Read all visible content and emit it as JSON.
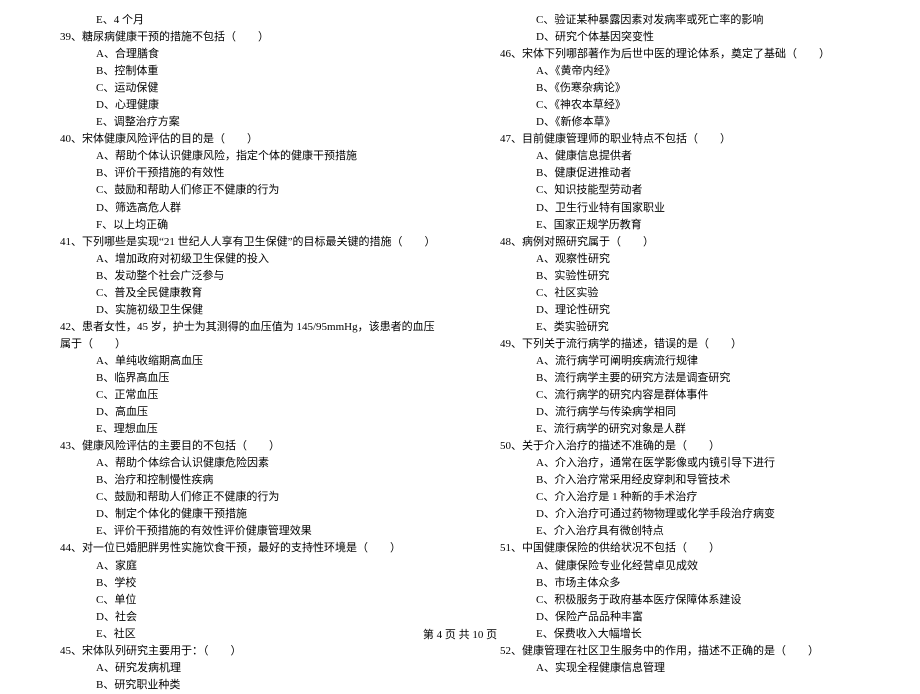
{
  "left_column": {
    "lines": [
      {
        "cls": "option-line",
        "text": "E、4 个月"
      },
      {
        "cls": "question-line",
        "text": "39、糖尿病健康干预的措施不包括（　　）"
      },
      {
        "cls": "option-line",
        "text": "A、合理膳食"
      },
      {
        "cls": "option-line",
        "text": "B、控制体重"
      },
      {
        "cls": "option-line",
        "text": "C、运动保健"
      },
      {
        "cls": "option-line",
        "text": "D、心理健康"
      },
      {
        "cls": "option-line",
        "text": "E、调整治疗方案"
      },
      {
        "cls": "question-line",
        "text": "40、宋体健康风险评估的目的是（　　）"
      },
      {
        "cls": "option-line",
        "text": "A、帮助个体认识健康风险，指定个体的健康干预措施"
      },
      {
        "cls": "option-line",
        "text": "B、评价干预措施的有效性"
      },
      {
        "cls": "option-line",
        "text": "C、鼓励和帮助人们修正不健康的行为"
      },
      {
        "cls": "option-line",
        "text": "D、筛选高危人群"
      },
      {
        "cls": "option-line",
        "text": "F、以上均正确"
      },
      {
        "cls": "question-line",
        "text": "41、下列哪些是实现“21 世纪人人享有卫生保健”的目标最关键的措施（　　）"
      },
      {
        "cls": "option-line",
        "text": "A、增加政府对初级卫生保健的投入"
      },
      {
        "cls": "option-line",
        "text": "B、发动整个社会广泛参与"
      },
      {
        "cls": "option-line",
        "text": "C、普及全民健康教育"
      },
      {
        "cls": "option-line",
        "text": "D、实施初级卫生保健"
      },
      {
        "cls": "question-line",
        "text": "42、患者女性，45 岁，护士为其测得的血压值为 145/95mmHg，该患者的血压属于（　　）"
      },
      {
        "cls": "option-line",
        "text": "A、单纯收缩期高血压"
      },
      {
        "cls": "option-line",
        "text": "B、临界高血压"
      },
      {
        "cls": "option-line",
        "text": "C、正常血压"
      },
      {
        "cls": "option-line",
        "text": "D、高血压"
      },
      {
        "cls": "option-line",
        "text": "E、理想血压"
      },
      {
        "cls": "question-line",
        "text": "43、健康风险评估的主要目的不包括（　　）"
      },
      {
        "cls": "option-line",
        "text": "A、帮助个体综合认识健康危险因素"
      },
      {
        "cls": "option-line",
        "text": "B、治疗和控制慢性疾病"
      },
      {
        "cls": "option-line",
        "text": "C、鼓励和帮助人们修正不健康的行为"
      },
      {
        "cls": "option-line",
        "text": "D、制定个体化的健康干预措施"
      },
      {
        "cls": "option-line",
        "text": "E、评价干预措施的有效性评价健康管理效果"
      },
      {
        "cls": "question-line",
        "text": "44、对一位已婚肥胖男性实施饮食干预，最好的支持性环境是（　　）"
      },
      {
        "cls": "option-line",
        "text": "A、家庭"
      },
      {
        "cls": "option-line",
        "text": "B、学校"
      },
      {
        "cls": "option-line",
        "text": "C、单位"
      },
      {
        "cls": "option-line",
        "text": "D、社会"
      },
      {
        "cls": "option-line",
        "text": "E、社区"
      },
      {
        "cls": "question-line",
        "text": "45、宋体队列研究主要用于：（　　）"
      },
      {
        "cls": "option-line",
        "text": "A、研究发病机理"
      },
      {
        "cls": "option-line",
        "text": "B、研究职业种类"
      }
    ]
  },
  "right_column": {
    "lines": [
      {
        "cls": "option-line",
        "text": "C、验证某种暴露因素对发病率或死亡率的影响"
      },
      {
        "cls": "option-line",
        "text": "D、研究个体基因突变性"
      },
      {
        "cls": "question-line",
        "text": "46、宋体下列哪部著作为后世中医的理论体系，奠定了基础（　　）"
      },
      {
        "cls": "option-line",
        "text": "A、《黄帝内经》"
      },
      {
        "cls": "option-line",
        "text": "B、《伤寒杂病论》"
      },
      {
        "cls": "option-line",
        "text": "C、《神农本草经》"
      },
      {
        "cls": "option-line",
        "text": "D、《新修本草》"
      },
      {
        "cls": "question-line",
        "text": "47、目前健康管理师的职业特点不包括（　　）"
      },
      {
        "cls": "option-line",
        "text": "A、健康信息提供者"
      },
      {
        "cls": "option-line",
        "text": "B、健康促进推动者"
      },
      {
        "cls": "option-line",
        "text": "C、知识技能型劳动者"
      },
      {
        "cls": "option-line",
        "text": "D、卫生行业特有国家职业"
      },
      {
        "cls": "option-line",
        "text": "E、国家正规学历教育"
      },
      {
        "cls": "question-line",
        "text": "48、病例对照研究属于（　　）"
      },
      {
        "cls": "option-line",
        "text": "A、观察性研究"
      },
      {
        "cls": "option-line",
        "text": "B、实验性研究"
      },
      {
        "cls": "option-line",
        "text": "C、社区实验"
      },
      {
        "cls": "option-line",
        "text": "D、理论性研究"
      },
      {
        "cls": "option-line",
        "text": "E、类实验研究"
      },
      {
        "cls": "question-line",
        "text": "49、下列关于流行病学的描述，错误的是（　　）"
      },
      {
        "cls": "option-line",
        "text": "A、流行病学可阐明疾病流行规律"
      },
      {
        "cls": "option-line",
        "text": "B、流行病学主要的研究方法是调查研究"
      },
      {
        "cls": "option-line",
        "text": "C、流行病学的研究内容是群体事件"
      },
      {
        "cls": "option-line",
        "text": "D、流行病学与传染病学相同"
      },
      {
        "cls": "option-line",
        "text": "E、流行病学的研究对象是人群"
      },
      {
        "cls": "question-line",
        "text": "50、关于介入治疗的描述不准确的是（　　）"
      },
      {
        "cls": "option-line",
        "text": "A、介入治疗，通常在医学影像或内镜引导下进行"
      },
      {
        "cls": "option-line",
        "text": "B、介入治疗常采用经皮穿刺和导管技术"
      },
      {
        "cls": "option-line",
        "text": "C、介入治疗是 1 种新的手术治疗"
      },
      {
        "cls": "option-line",
        "text": "D、介入治疗可通过药物物理或化学手段治疗病变"
      },
      {
        "cls": "option-line",
        "text": "E、介入治疗具有微创特点"
      },
      {
        "cls": "question-line",
        "text": "51、中国健康保险的供给状况不包括（　　）"
      },
      {
        "cls": "option-line",
        "text": "A、健康保险专业化经营卓见成效"
      },
      {
        "cls": "option-line",
        "text": "B、市场主体众多"
      },
      {
        "cls": "option-line",
        "text": "C、积极服务于政府基本医疗保障体系建设"
      },
      {
        "cls": "option-line",
        "text": "D、保险产品品种丰富"
      },
      {
        "cls": "option-line",
        "text": "E、保费收入大幅增长"
      },
      {
        "cls": "question-line",
        "text": "52、健康管理在社区卫生服务中的作用，描述不正确的是（　　）"
      },
      {
        "cls": "option-line",
        "text": "A、实现全程健康信息管理"
      }
    ]
  },
  "footer": "第 4 页 共 10 页"
}
